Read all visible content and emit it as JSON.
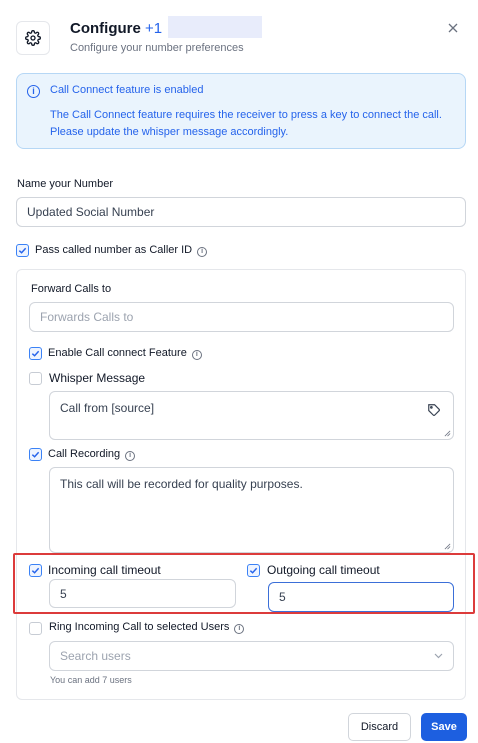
{
  "header": {
    "title": "Configure",
    "number_prefix": "+1",
    "subtitle": "Configure your number preferences"
  },
  "notice": {
    "title": "Call Connect feature is enabled",
    "body": "The Call Connect feature requires the receiver to press a key to connect the call. Please update the whisper message accordingly."
  },
  "name_field": {
    "label": "Name your Number",
    "value": "Updated Social Number"
  },
  "pass_caller_id": {
    "label": "Pass called number as Caller ID",
    "checked": true
  },
  "forward": {
    "label": "Forward Calls to",
    "placeholder": "Forwards Calls to"
  },
  "call_connect": {
    "label": "Enable Call connect Feature",
    "checked": true
  },
  "whisper": {
    "label": "Whisper Message",
    "checked": false,
    "value": "Call from [source]"
  },
  "recording": {
    "label": "Call Recording",
    "checked": true,
    "value": "This call will be recorded for quality purposes."
  },
  "incoming_timeout": {
    "label": "Incoming call timeout",
    "checked": true,
    "value": "5"
  },
  "outgoing_timeout": {
    "label": "Outgoing call timeout",
    "checked": true,
    "value": "5"
  },
  "ring_users": {
    "label": "Ring Incoming Call to selected Users",
    "checked": false,
    "placeholder": "Search users",
    "hint": "You can add 7 users"
  },
  "buttons": {
    "discard": "Discard",
    "save": "Save"
  },
  "colors": {
    "accent": "#1d5fe0",
    "info_bg": "#eaf4fd",
    "highlight": "#dc3b3b"
  }
}
